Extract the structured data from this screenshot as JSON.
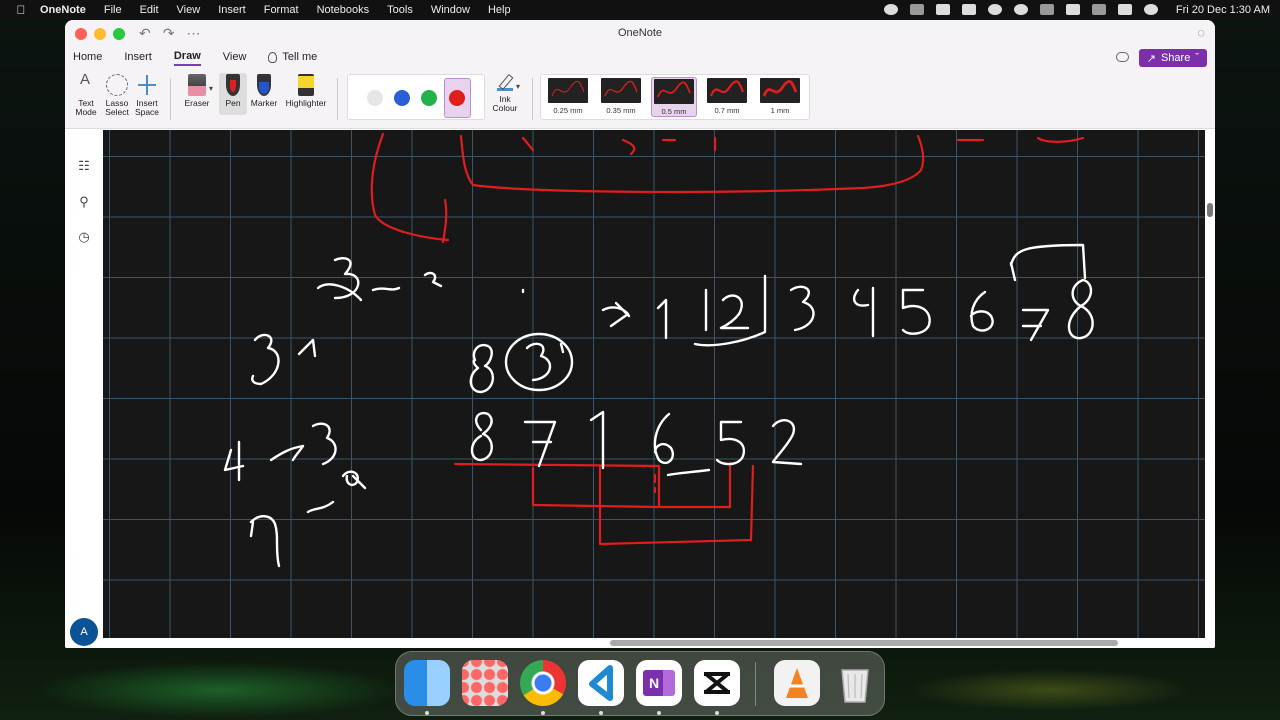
{
  "menubar": {
    "app": "OneNote",
    "items": [
      "File",
      "Edit",
      "View",
      "Insert",
      "Format",
      "Notebooks",
      "Tools",
      "Window",
      "Help"
    ],
    "clock": "Fri 20 Dec  1:30 AM"
  },
  "window": {
    "title": "OneNote"
  },
  "tabs": [
    "Home",
    "Insert",
    "Draw",
    "View"
  ],
  "active_tab": "Draw",
  "tell_me": "Tell me",
  "share_label": "Share",
  "ribbon": {
    "text_mode": "Text\nMode",
    "lasso": "Lasso\nSelect",
    "insert_space": "Insert\nSpace",
    "eraser": "Eraser",
    "pen": "Pen",
    "marker": "Marker",
    "highlighter": "Highlighter",
    "ink_colour": "Ink\nColour",
    "pen_colors": [
      "#e6e6e6",
      "#2a5fd8",
      "#22b24a",
      "#e01e1e"
    ],
    "selected_color": "#e01e1e",
    "widths": [
      "0.25 mm",
      "0.35 mm",
      "0.5 mm",
      "0.7 mm",
      "1 mm"
    ],
    "selected_width": "0.5 mm"
  },
  "avatar_initial": "A",
  "colors": {
    "accent": "#7b2fa8",
    "ink_white": "#ffffff",
    "ink_red": "#e01e1e",
    "grid": "#3a5567"
  },
  "dock": {
    "apps": [
      "finder-icon",
      "launchpad-icon",
      "chrome-icon",
      "vscode-icon",
      "onenote-icon",
      "capcut-icon",
      "vlc-icon",
      "trash-icon"
    ]
  }
}
